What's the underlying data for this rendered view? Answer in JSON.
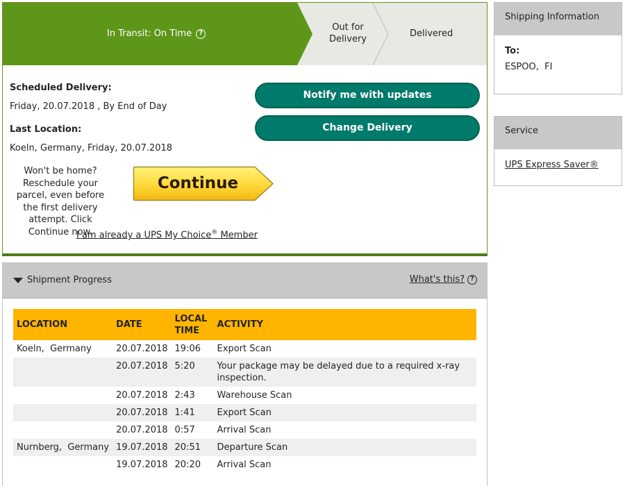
{
  "progress": {
    "current_step": "In Transit: On Time",
    "step_out": "Out for Delivery",
    "step_delivered": "Delivered"
  },
  "details": {
    "scheduled_label": "Scheduled Delivery:",
    "scheduled_value": "Friday, 20.07.2018 , By End of Day",
    "last_location_label": "Last Location:",
    "last_location_value": "Koeln, Germany, Friday, 20.07.2018"
  },
  "actions": {
    "notify_label": "Notify me with updates",
    "change_label": "Change Delivery",
    "wont_home_text": "Won't be home? Reschedule your parcel, even before the first delivery attempt. Click Continue now.",
    "continue_label": "Continue",
    "member_link_pre": "I am already a UPS My Choice",
    "member_link_reg": "®",
    "member_link_post": " Member"
  },
  "shipping_info": {
    "title": "Shipping Information",
    "to_label": "To:",
    "to_value": "ESPOO,  FI"
  },
  "service": {
    "title": "Service",
    "value": "UPS Express Saver®"
  },
  "shipment_progress": {
    "title": "Shipment Progress",
    "whats_this": "What's this?",
    "columns": [
      "LOCATION",
      "DATE",
      "LOCAL TIME",
      "ACTIVITY"
    ],
    "rows": [
      {
        "location": "Koeln,  Germany",
        "date": "20.07.2018",
        "time": "19:06",
        "activity": "Export Scan"
      },
      {
        "location": "",
        "date": "20.07.2018",
        "time": "5:20",
        "activity": "Your package may be delayed due to a required x-ray inspection."
      },
      {
        "location": "",
        "date": "20.07.2018",
        "time": "2:43",
        "activity": "Warehouse Scan"
      },
      {
        "location": "",
        "date": "20.07.2018",
        "time": "1:41",
        "activity": "Export Scan"
      },
      {
        "location": "",
        "date": "20.07.2018",
        "time": "0:57",
        "activity": "Arrival Scan"
      },
      {
        "location": "Nurnberg,  Germany",
        "date": "19.07.2018",
        "time": "20:51",
        "activity": "Departure Scan"
      },
      {
        "location": "",
        "date": "19.07.2018",
        "time": "20:20",
        "activity": "Arrival Scan"
      }
    ]
  },
  "colors": {
    "progress_green": "#5e961a",
    "button_teal": "#007a6a",
    "table_header_amber": "#ffb500",
    "continue_yellow": "#ffd93a"
  }
}
